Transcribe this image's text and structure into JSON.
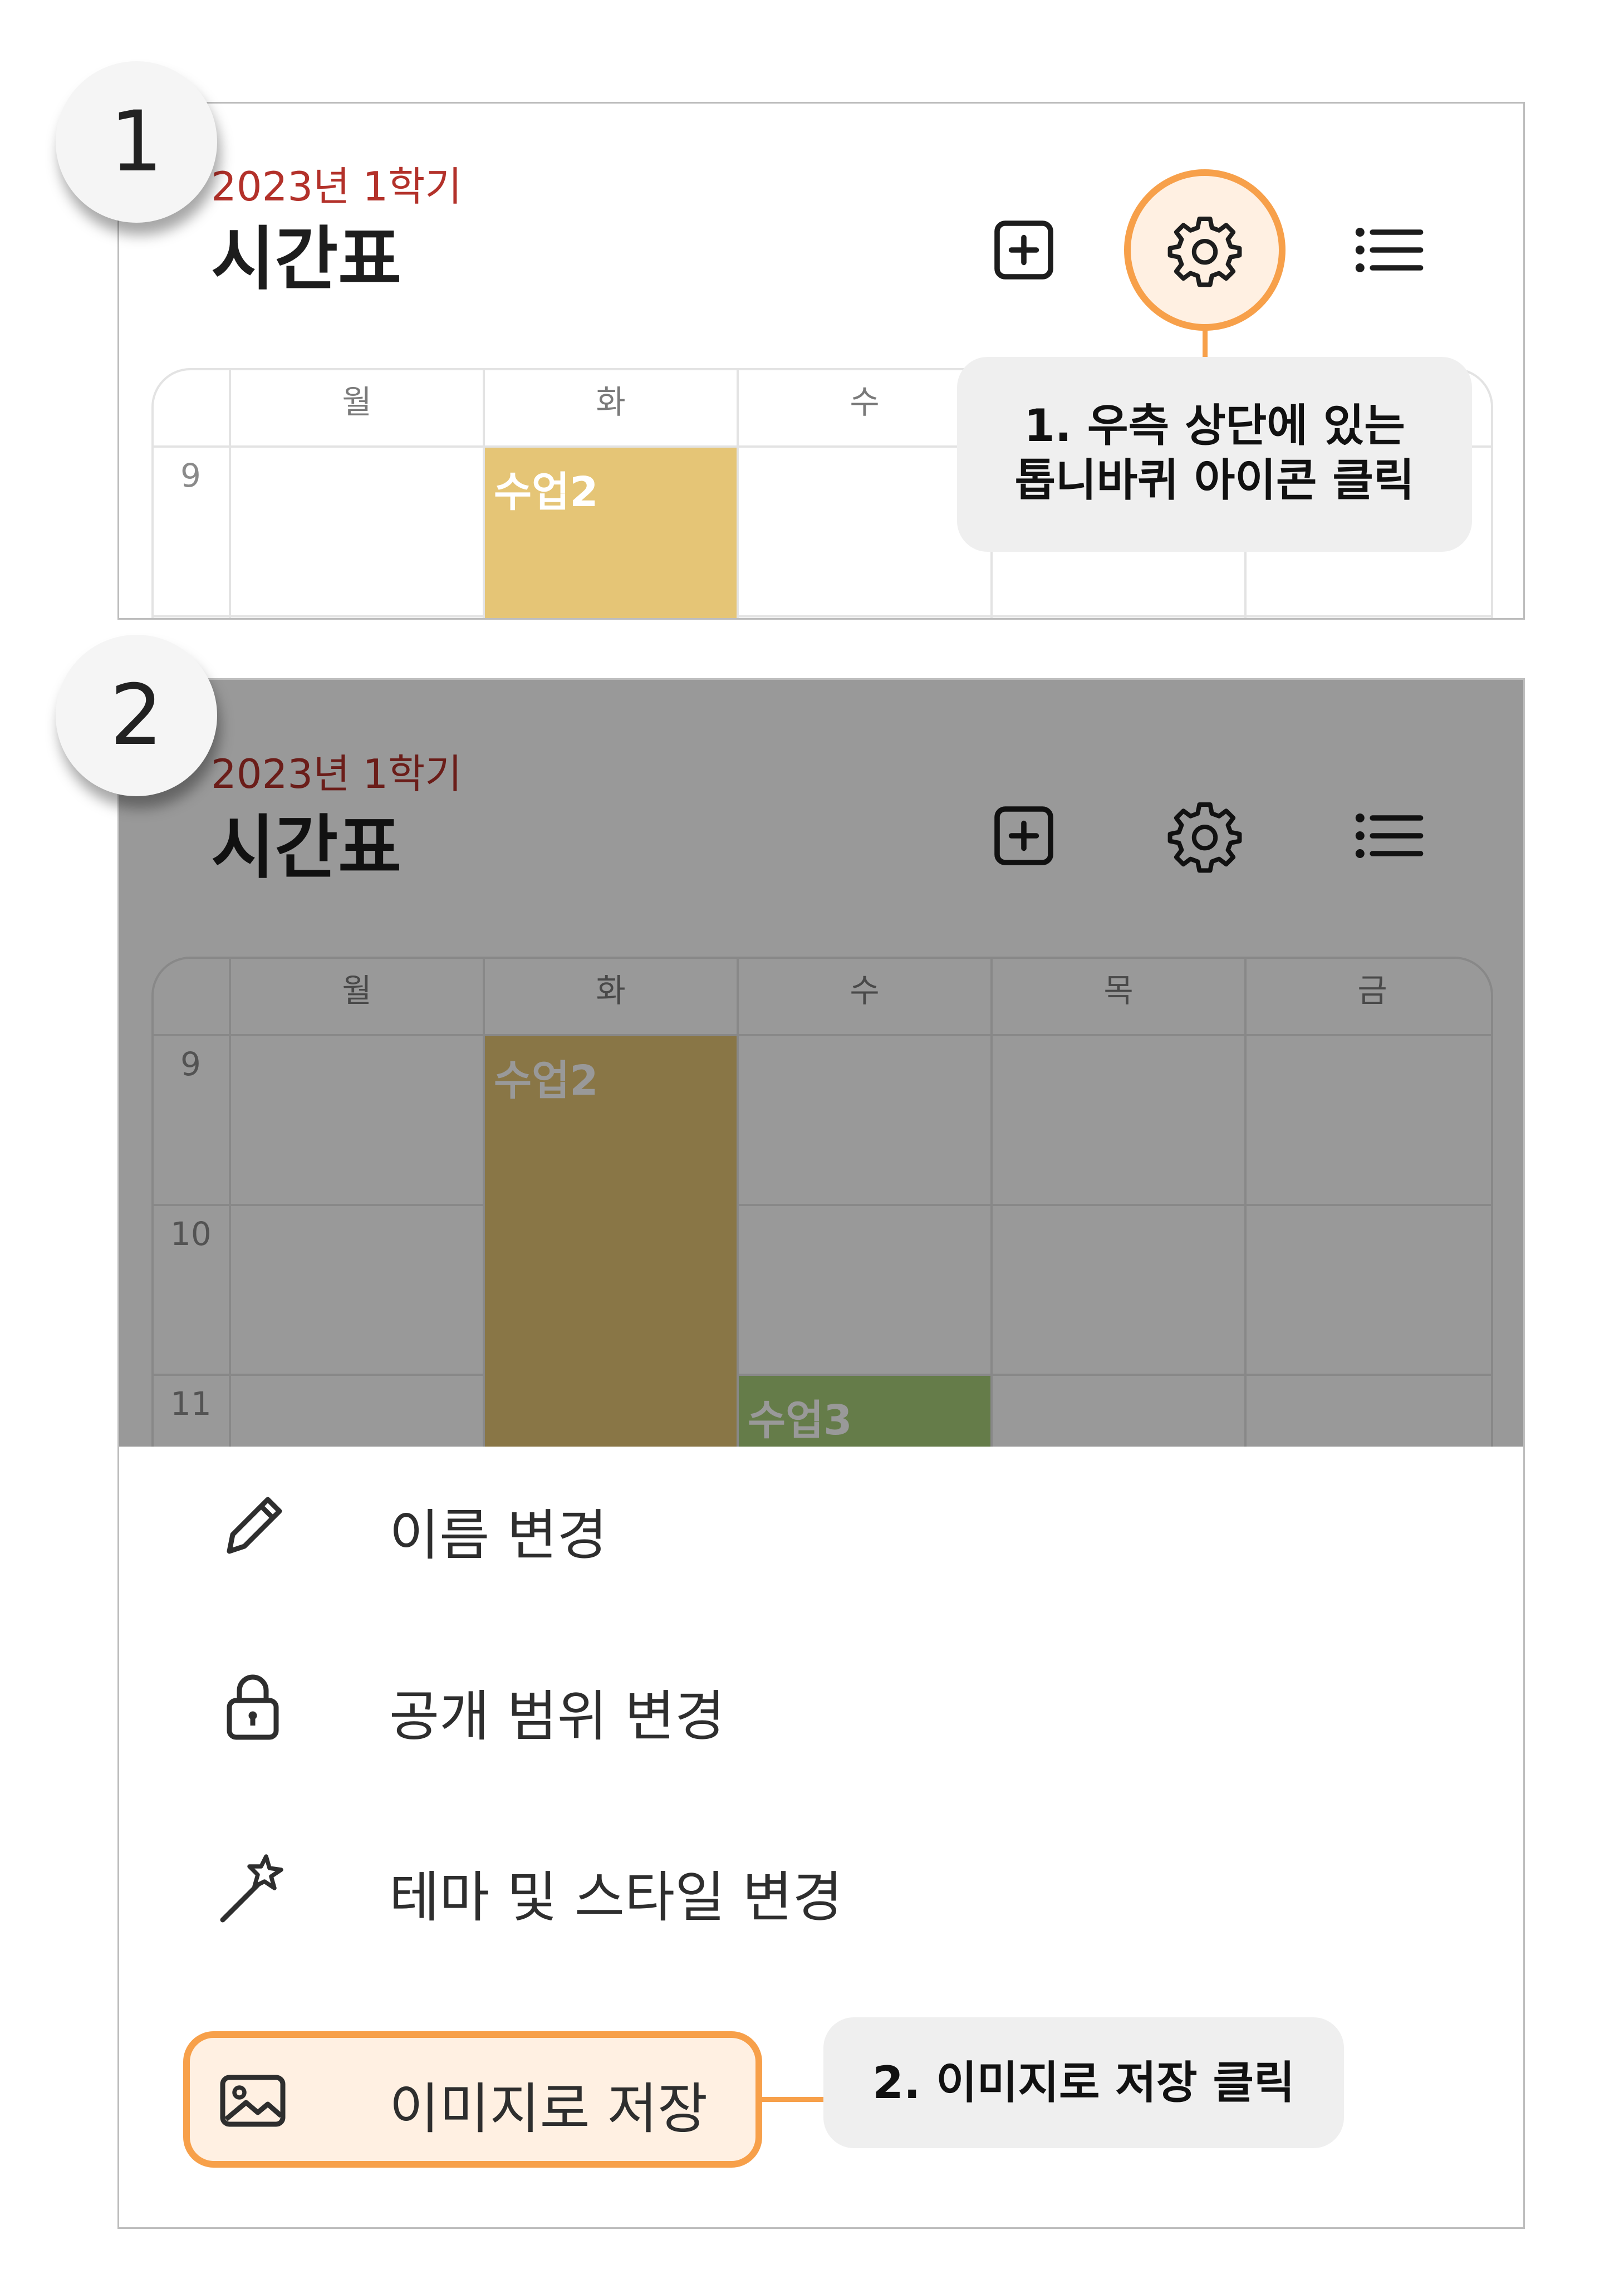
{
  "steps": [
    {
      "number": "1",
      "callout": [
        "1. 우측 상단에 있는",
        "톱니바퀴 아이콘 클릭"
      ]
    },
    {
      "number": "2",
      "callout": "2. 이미지로 저장 클릭"
    }
  ],
  "timetable": {
    "semester": "2023년 1학기",
    "title": "시간표",
    "days": [
      "월",
      "화",
      "수",
      "목",
      "금"
    ],
    "hours": [
      "9",
      "10",
      "11"
    ],
    "classes": [
      {
        "name": "수업2",
        "day": "화",
        "color": "#e5c576"
      },
      {
        "name": "수업3",
        "day": "수",
        "color": "#a8cf7a"
      }
    ],
    "header_icons": [
      "add-square-icon",
      "gear-icon",
      "list-icon"
    ]
  },
  "menu": {
    "items": [
      {
        "label": "이름 변경",
        "icon": "pencil-icon"
      },
      {
        "label": "공개 범위 변경",
        "icon": "lock-icon"
      },
      {
        "label": "테마 및 스타일 변경",
        "icon": "magic-wand-icon"
      },
      {
        "label": "이미지로 저장",
        "icon": "image-icon",
        "highlighted": true
      }
    ]
  },
  "colors": {
    "highlight": "#f7a04a",
    "highlight_fill": "#fff0e2",
    "semester_red": "#b3312a",
    "callout_bg": "#efefef"
  }
}
